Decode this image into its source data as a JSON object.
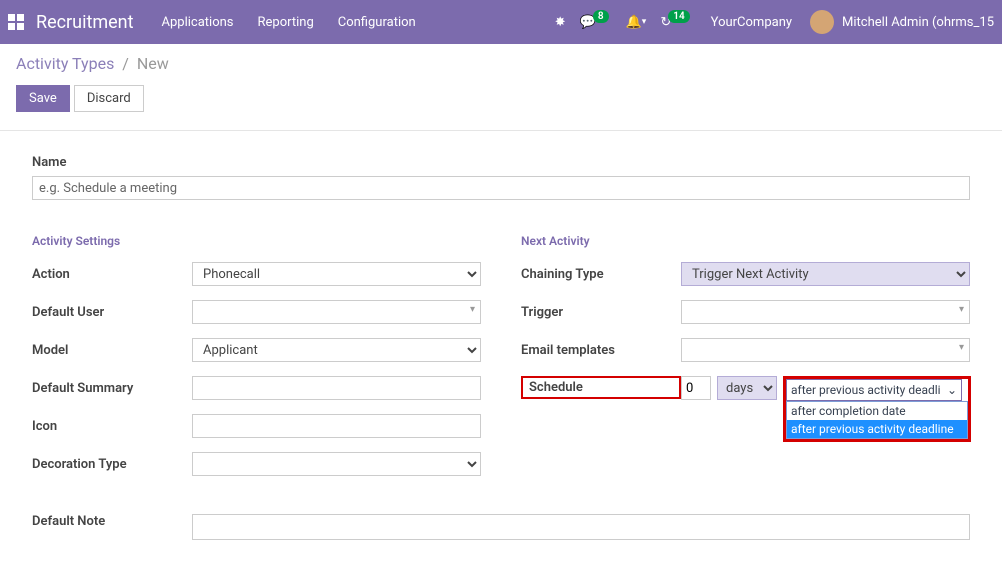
{
  "nav": {
    "brand": "Recruitment",
    "links": [
      "Applications",
      "Reporting",
      "Configuration"
    ],
    "badge1": "8",
    "badge2": "14",
    "company": "YourCompany",
    "user": "Mitchell Admin (ohrms_15"
  },
  "breadcrumb": {
    "root": "Activity Types",
    "current": "New"
  },
  "actions": {
    "save": "Save",
    "discard": "Discard"
  },
  "form": {
    "name_label": "Name",
    "name_placeholder": "e.g. Schedule a meeting",
    "section_left": "Activity Settings",
    "section_right": "Next Activity",
    "labels": {
      "action": "Action",
      "default_user": "Default User",
      "model": "Model",
      "default_summary": "Default Summary",
      "icon": "Icon",
      "decoration_type": "Decoration Type",
      "default_note": "Default Note",
      "chaining_type": "Chaining Type",
      "trigger": "Trigger",
      "email_templates": "Email templates",
      "schedule": "Schedule"
    },
    "values": {
      "action": "Phonecall",
      "model": "Applicant",
      "chaining_type": "Trigger Next Activity",
      "schedule_num": "0",
      "schedule_unit": "days",
      "schedule_from": "after previous activity deadline"
    },
    "dropdown_options": [
      "after completion date",
      "after previous activity deadline"
    ]
  }
}
